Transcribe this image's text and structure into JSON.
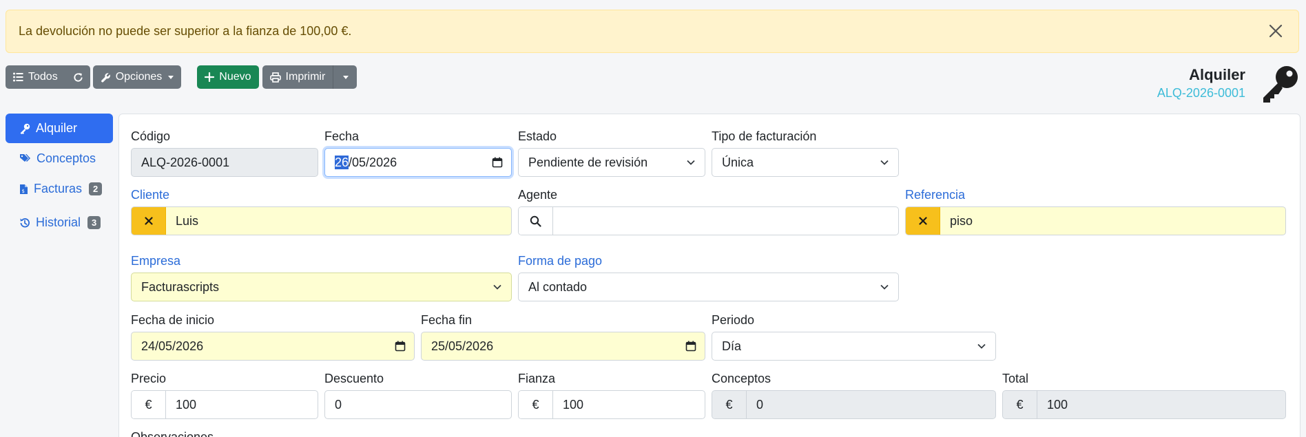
{
  "alert": {
    "message": "La devolución no puede ser superior a la fianza de 100,00 €."
  },
  "toolbar": {
    "all_label": "Todos",
    "options_label": "Opciones",
    "new_label": "Nuevo",
    "print_label": "Imprimir"
  },
  "header": {
    "title": "Alquiler",
    "code": "ALQ-2026-0001"
  },
  "sidebar": {
    "items": [
      {
        "label": "Alquiler"
      },
      {
        "label": "Conceptos"
      },
      {
        "label": "Facturas",
        "badge": "2"
      },
      {
        "label": "Historial",
        "badge": "3"
      }
    ]
  },
  "form": {
    "codigo": {
      "label": "Código",
      "value": "ALQ-2026-0001"
    },
    "fecha": {
      "label": "Fecha",
      "value_day": "26",
      "value_rest": "/05/2026"
    },
    "estado": {
      "label": "Estado",
      "value": "Pendiente de revisión"
    },
    "tipo_facturacion": {
      "label": "Tipo de facturación",
      "value": "Única"
    },
    "cliente": {
      "label": "Cliente",
      "value": "Luis"
    },
    "agente": {
      "label": "Agente",
      "value": ""
    },
    "referencia": {
      "label": "Referencia",
      "value": "piso"
    },
    "empresa": {
      "label": "Empresa",
      "value": "Facturascripts"
    },
    "forma_pago": {
      "label": "Forma de pago",
      "value": "Al contado"
    },
    "fecha_inicio": {
      "label": "Fecha de inicio",
      "value": "24/05/2026"
    },
    "fecha_fin": {
      "label": "Fecha fin",
      "value": "25/05/2026"
    },
    "periodo": {
      "label": "Periodo",
      "value": "Día"
    },
    "precio": {
      "label": "Precio",
      "value": "100"
    },
    "descuento": {
      "label": "Descuento",
      "value": "0"
    },
    "fianza": {
      "label": "Fianza",
      "value": "100"
    },
    "conceptos": {
      "label": "Conceptos",
      "value": "0"
    },
    "total": {
      "label": "Total",
      "value": "100"
    },
    "observaciones": {
      "label": "Observaciones"
    },
    "currency_symbol": "€"
  },
  "colors": {
    "primary": "#2f6df0",
    "success": "#198754",
    "secondary": "#6c757d",
    "warning": "#f7c01c",
    "alert_bg": "#fff3cd",
    "info": "#3dbcd8"
  }
}
